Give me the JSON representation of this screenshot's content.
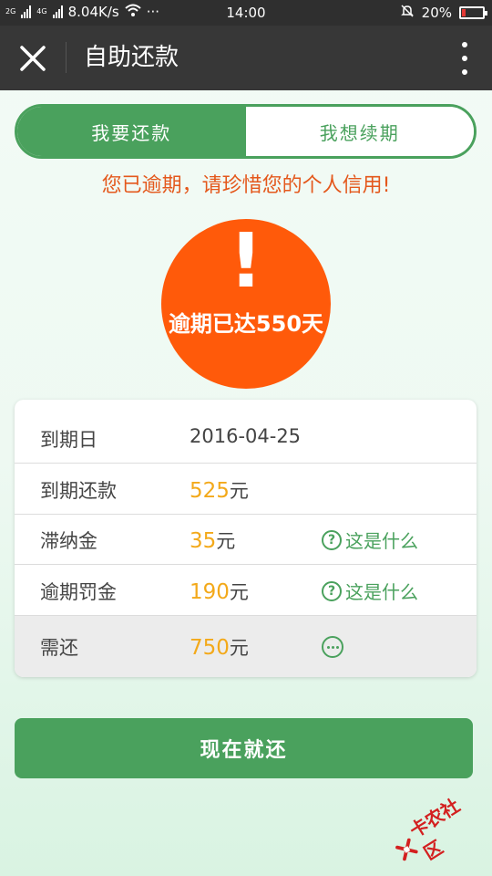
{
  "status_bar": {
    "net_type_top": "2G",
    "net_type_mid": "4G",
    "net_type_bot": "2G",
    "speed": "8.04K/s",
    "dots": "···",
    "time": "14:00",
    "battery": "20%",
    "battery_level": 0.2
  },
  "header": {
    "title": "自助还款",
    "close_icon": "close-icon",
    "more_icon": "more-vertical-icon"
  },
  "tabs": [
    {
      "label": "我要还款",
      "active": true
    },
    {
      "label": "我想续期",
      "active": false
    }
  ],
  "warning": "您已逾期，请珍惜您的个人信用!",
  "alert": {
    "mark": "!",
    "text": "逾期已达550天"
  },
  "details": {
    "due_date_label": "到期日",
    "due_date_value": "2016-04-25",
    "due_amount_label": "到期还款",
    "due_amount_value": "525",
    "late_fee_label": "滞纳金",
    "late_fee_value": "35",
    "penalty_label": "逾期罚金",
    "penalty_value": "190",
    "total_label": "需还",
    "total_value": "750",
    "unit": "元",
    "help_text": "这是什么",
    "help_icon": "question-circle-icon",
    "more_icon": "ellipsis-circle-icon"
  },
  "pay_button": "现在就还",
  "watermark": "卡农社区",
  "colors": {
    "accent": "#4aa15d",
    "warning": "#e4581c",
    "alert_circle": "#ff5a0a",
    "amount": "#f3a91a"
  }
}
